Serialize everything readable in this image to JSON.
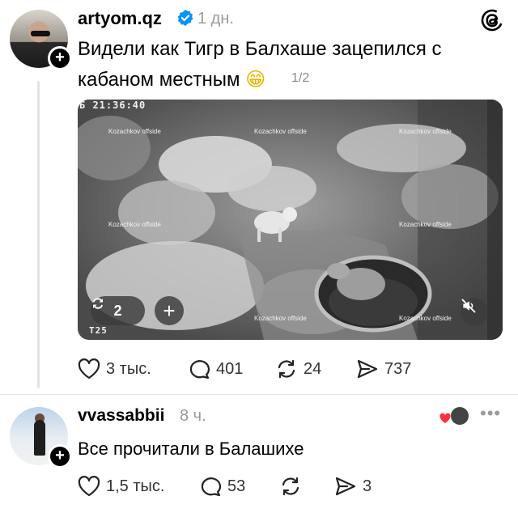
{
  "post": {
    "username": "artyom.qz",
    "time": "1 дн.",
    "text_line1": "Видели как Тигр в Балхаше зацепился с",
    "text_line2": "кабаном местным",
    "emoji": "😁",
    "media_counter": "1/2",
    "media": {
      "timestamp": "Б 21:36:40",
      "watermark": "Kozachkov offside",
      "corner_label": "T25",
      "repost_count": "2"
    },
    "actions": {
      "likes": "3 тыс.",
      "replies": "401",
      "reposts": "24",
      "shares": "737"
    }
  },
  "reply": {
    "username": "vvassabbii",
    "time": "8 ч.",
    "text": "Все прочитали в Балашихе",
    "actions": {
      "likes": "1,5 тыс.",
      "replies": "53",
      "shares": "3"
    }
  },
  "colors": {
    "verified": "#0095f6",
    "liked_heart": "#ff3040",
    "muted_text": "#9a9a9a"
  },
  "icons": [
    "threads-logo-icon",
    "verified-badge-icon",
    "plus-icon",
    "heart-icon",
    "comment-icon",
    "repost-icon",
    "share-icon",
    "mute-icon",
    "more-icon"
  ]
}
